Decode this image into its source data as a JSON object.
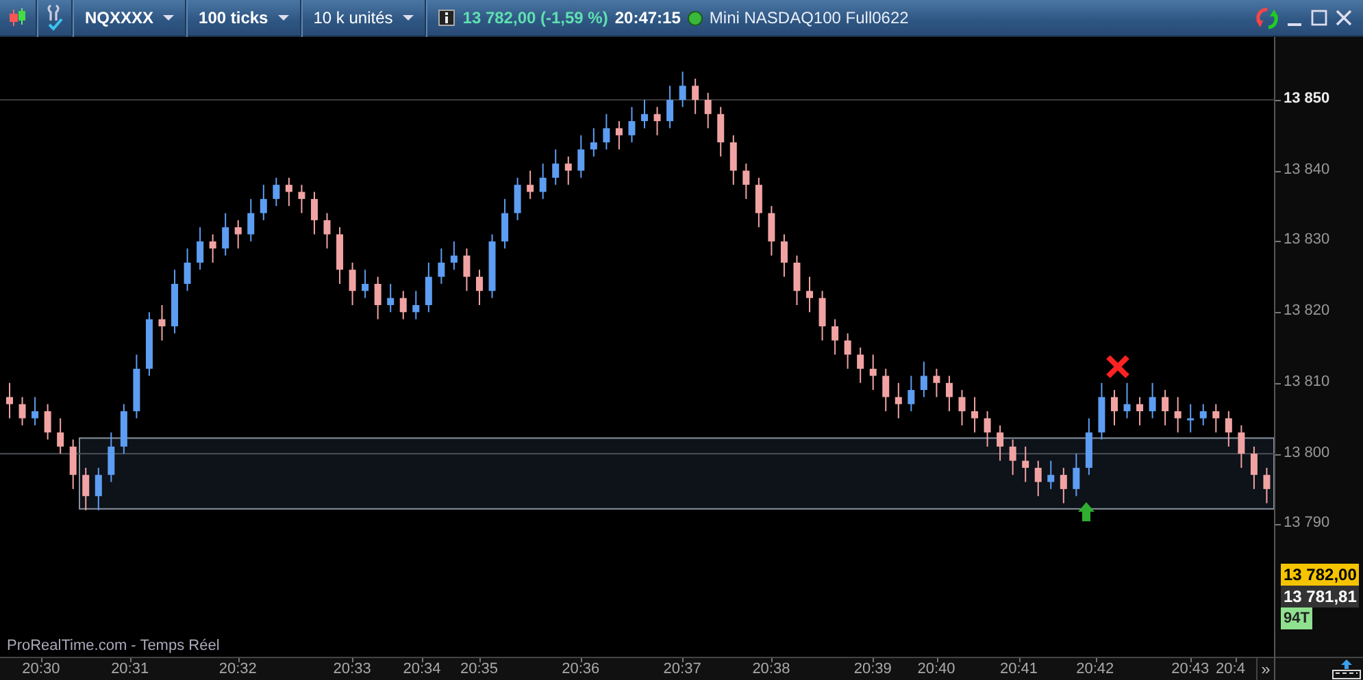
{
  "toolbar": {
    "instrument": "NQXXXX",
    "period": "100 ticks",
    "units": "10 k unités",
    "quote": "13 782,00 (-1,59 %)",
    "time": "20:47:15",
    "name": "Mini NASDAQ100 Full0622"
  },
  "chart": {
    "source": "ProRealTime.com - Temps Réel",
    "chart_data": {
      "type": "candlestick",
      "categories": [
        null,
        null,
        null,
        null,
        null,
        null,
        null,
        null,
        null,
        null,
        null,
        null,
        null,
        null,
        null,
        null,
        null,
        null,
        null,
        null,
        null,
        null,
        null,
        null,
        null,
        null,
        null,
        null,
        null,
        null,
        null,
        null,
        null,
        null,
        null,
        null,
        null,
        null,
        null,
        null,
        null,
        null,
        null,
        null,
        null,
        null,
        null,
        null,
        null,
        null,
        null,
        null,
        null,
        null,
        null,
        null,
        null,
        null,
        null,
        null,
        null,
        null,
        null,
        null,
        null,
        null,
        null,
        null,
        null,
        null,
        null,
        null,
        null,
        null,
        null,
        null,
        null,
        null,
        null,
        null,
        null,
        null,
        null,
        null,
        null,
        null,
        null,
        null,
        null,
        null,
        null,
        null,
        null,
        null,
        null,
        null,
        null,
        null,
        null,
        null
      ],
      "ohlc": [
        [
          13808,
          13810,
          13805,
          13807
        ],
        [
          13807,
          13808,
          13804,
          13805
        ],
        [
          13805,
          13808,
          13804,
          13806
        ],
        [
          13806,
          13807,
          13802,
          13803
        ],
        [
          13803,
          13805,
          13800,
          13801
        ],
        [
          13801,
          13802,
          13795,
          13797
        ],
        [
          13797,
          13798,
          13792,
          13794
        ],
        [
          13794,
          13798,
          13792,
          13797
        ],
        [
          13797,
          13803,
          13796,
          13801
        ],
        [
          13801,
          13807,
          13800,
          13806
        ],
        [
          13806,
          13814,
          13805,
          13812
        ],
        [
          13812,
          13820,
          13811,
          13819
        ],
        [
          13819,
          13821,
          13816,
          13818
        ],
        [
          13818,
          13826,
          13817,
          13824
        ],
        [
          13824,
          13829,
          13823,
          13827
        ],
        [
          13827,
          13832,
          13826,
          13830
        ],
        [
          13830,
          13831,
          13827,
          13829
        ],
        [
          13829,
          13834,
          13828,
          13832
        ],
        [
          13832,
          13833,
          13829,
          13831
        ],
        [
          13831,
          13836,
          13830,
          13834
        ],
        [
          13834,
          13838,
          13833,
          13836
        ],
        [
          13836,
          13839,
          13835,
          13838
        ],
        [
          13838,
          13839,
          13835,
          13837
        ],
        [
          13837,
          13838,
          13834,
          13836
        ],
        [
          13836,
          13837,
          13831,
          13833
        ],
        [
          13833,
          13834,
          13829,
          13831
        ],
        [
          13831,
          13832,
          13824,
          13826
        ],
        [
          13826,
          13827,
          13821,
          13823
        ],
        [
          13823,
          13826,
          13822,
          13824
        ],
        [
          13824,
          13825,
          13819,
          13821
        ],
        [
          13821,
          13824,
          13820,
          13822
        ],
        [
          13822,
          13823,
          13819,
          13820
        ],
        [
          13820,
          13823,
          13819,
          13821
        ],
        [
          13821,
          13827,
          13820,
          13825
        ],
        [
          13825,
          13829,
          13824,
          13827
        ],
        [
          13827,
          13830,
          13826,
          13828
        ],
        [
          13828,
          13829,
          13823,
          13825
        ],
        [
          13825,
          13826,
          13821,
          13823
        ],
        [
          13823,
          13831,
          13822,
          13830
        ],
        [
          13830,
          13836,
          13829,
          13834
        ],
        [
          13834,
          13839,
          13833,
          13838
        ],
        [
          13838,
          13840,
          13836,
          13837
        ],
        [
          13837,
          13841,
          13836,
          13839
        ],
        [
          13839,
          13843,
          13838,
          13841
        ],
        [
          13841,
          13842,
          13838,
          13840
        ],
        [
          13840,
          13845,
          13839,
          13843
        ],
        [
          13843,
          13846,
          13842,
          13844
        ],
        [
          13844,
          13848,
          13843,
          13846
        ],
        [
          13846,
          13847,
          13843,
          13845
        ],
        [
          13845,
          13849,
          13844,
          13847
        ],
        [
          13847,
          13850,
          13846,
          13848
        ],
        [
          13848,
          13849,
          13845,
          13847
        ],
        [
          13847,
          13852,
          13846,
          13850
        ],
        [
          13850,
          13854,
          13849,
          13852
        ],
        [
          13852,
          13853,
          13848,
          13850
        ],
        [
          13850,
          13851,
          13846,
          13848
        ],
        [
          13848,
          13849,
          13842,
          13844
        ],
        [
          13844,
          13845,
          13838,
          13840
        ],
        [
          13840,
          13841,
          13836,
          13838
        ],
        [
          13838,
          13839,
          13832,
          13834
        ],
        [
          13834,
          13835,
          13828,
          13830
        ],
        [
          13830,
          13831,
          13825,
          13827
        ],
        [
          13827,
          13828,
          13821,
          13823
        ],
        [
          13823,
          13825,
          13820,
          13822
        ],
        [
          13822,
          13823,
          13816,
          13818
        ],
        [
          13818,
          13819,
          13814,
          13816
        ],
        [
          13816,
          13817,
          13812,
          13814
        ],
        [
          13814,
          13815,
          13810,
          13812
        ],
        [
          13812,
          13814,
          13809,
          13811
        ],
        [
          13811,
          13812,
          13806,
          13808
        ],
        [
          13808,
          13810,
          13805,
          13807
        ],
        [
          13807,
          13811,
          13806,
          13809
        ],
        [
          13809,
          13813,
          13808,
          13811
        ],
        [
          13811,
          13812,
          13808,
          13810
        ],
        [
          13810,
          13811,
          13806,
          13808
        ],
        [
          13808,
          13809,
          13804,
          13806
        ],
        [
          13806,
          13808,
          13803,
          13805
        ],
        [
          13805,
          13806,
          13801,
          13803
        ],
        [
          13803,
          13804,
          13799,
          13801
        ],
        [
          13801,
          13802,
          13797,
          13799
        ],
        [
          13799,
          13801,
          13796,
          13798
        ],
        [
          13798,
          13799,
          13794,
          13796
        ],
        [
          13796,
          13799,
          13795,
          13797
        ],
        [
          13797,
          13798,
          13793,
          13795
        ],
        [
          13795,
          13800,
          13794,
          13798
        ],
        [
          13798,
          13805,
          13797,
          13803
        ],
        [
          13803,
          13810,
          13802,
          13808
        ],
        [
          13808,
          13809,
          13804,
          13806
        ],
        [
          13806,
          13810,
          13805,
          13807
        ],
        [
          13807,
          13808,
          13804,
          13806
        ],
        [
          13806,
          13810,
          13805,
          13808
        ],
        [
          13808,
          13809,
          13804,
          13806
        ],
        [
          13806,
          13808,
          13803,
          13805
        ],
        [
          13805,
          13807,
          13803,
          13805
        ],
        [
          13805,
          13807,
          13804,
          13806
        ],
        [
          13806,
          13807,
          13803,
          13805
        ],
        [
          13805,
          13806,
          13801,
          13803
        ],
        [
          13803,
          13804,
          13798,
          13800
        ],
        [
          13800,
          13801,
          13795,
          13797
        ],
        [
          13797,
          13798,
          13793,
          13795
        ]
      ],
      "ylim": [
        13771.3,
        13858.9
      ],
      "yticks": [
        {
          "value": 13850,
          "label": "13 850"
        },
        {
          "value": 13840,
          "label": "13 840"
        },
        {
          "value": 13830,
          "label": "13 830"
        },
        {
          "value": 13820,
          "label": "13 820"
        },
        {
          "value": 13810,
          "label": "13 810"
        },
        {
          "value": 13800,
          "label": "13 800"
        },
        {
          "value": 13790,
          "label": "13 790"
        }
      ],
      "ref_lines": [
        {
          "axis": "y",
          "value": 13850
        },
        {
          "axis": "y",
          "value": 13800
        }
      ],
      "bands": [
        {
          "axis": "y",
          "from": 13792.2,
          "to": 13802.2
        }
      ]
    },
    "time_labels": [
      "20:30",
      "20:31",
      "20:32",
      "20:33",
      "20:34",
      "20:35",
      "20:36",
      "20:37",
      "20:38",
      "20:39",
      "20:40",
      "20:41",
      "20:42",
      "20:43",
      "20:4"
    ],
    "scroll_button": "»",
    "price_tags": [
      {
        "text": "13 782,00",
        "kind": "last"
      },
      {
        "text": "13 781,81",
        "kind": "bid"
      },
      {
        "text": "94T",
        "kind": "ticks"
      }
    ]
  }
}
